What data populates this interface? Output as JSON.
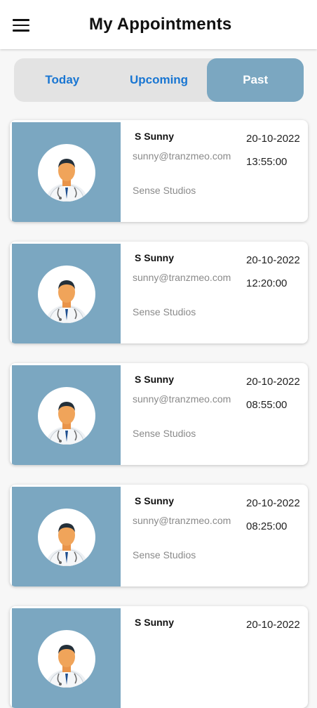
{
  "header": {
    "title": "My Appointments",
    "menu_icon": "hamburger-menu-icon"
  },
  "tabs": [
    {
      "label": "Today",
      "active": false
    },
    {
      "label": "Upcoming",
      "active": false
    },
    {
      "label": "Past",
      "active": true
    }
  ],
  "colors": {
    "accent": "#7ba7c1",
    "tab_text": "#1976d2",
    "secondary_text": "#8a8a8a"
  },
  "appointments": [
    {
      "name": "S  Sunny",
      "email": "sunny@tranzmeo.com",
      "company": "Sense Studios",
      "date": "20-10-2022",
      "time": "13:55:00",
      "avatar_icon": "doctor-avatar-icon"
    },
    {
      "name": "S  Sunny",
      "email": "sunny@tranzmeo.com",
      "company": "Sense Studios",
      "date": "20-10-2022",
      "time": "12:20:00",
      "avatar_icon": "doctor-avatar-icon"
    },
    {
      "name": "S  Sunny",
      "email": "sunny@tranzmeo.com",
      "company": "Sense Studios",
      "date": "20-10-2022",
      "time": "08:55:00",
      "avatar_icon": "doctor-avatar-icon"
    },
    {
      "name": "S  Sunny",
      "email": "sunny@tranzmeo.com",
      "company": "Sense Studios",
      "date": "20-10-2022",
      "time": "08:25:00",
      "avatar_icon": "doctor-avatar-icon"
    },
    {
      "name": "S  Sunny",
      "email": "",
      "company": "",
      "date": "20-10-2022",
      "time": "",
      "avatar_icon": "doctor-avatar-icon"
    }
  ]
}
